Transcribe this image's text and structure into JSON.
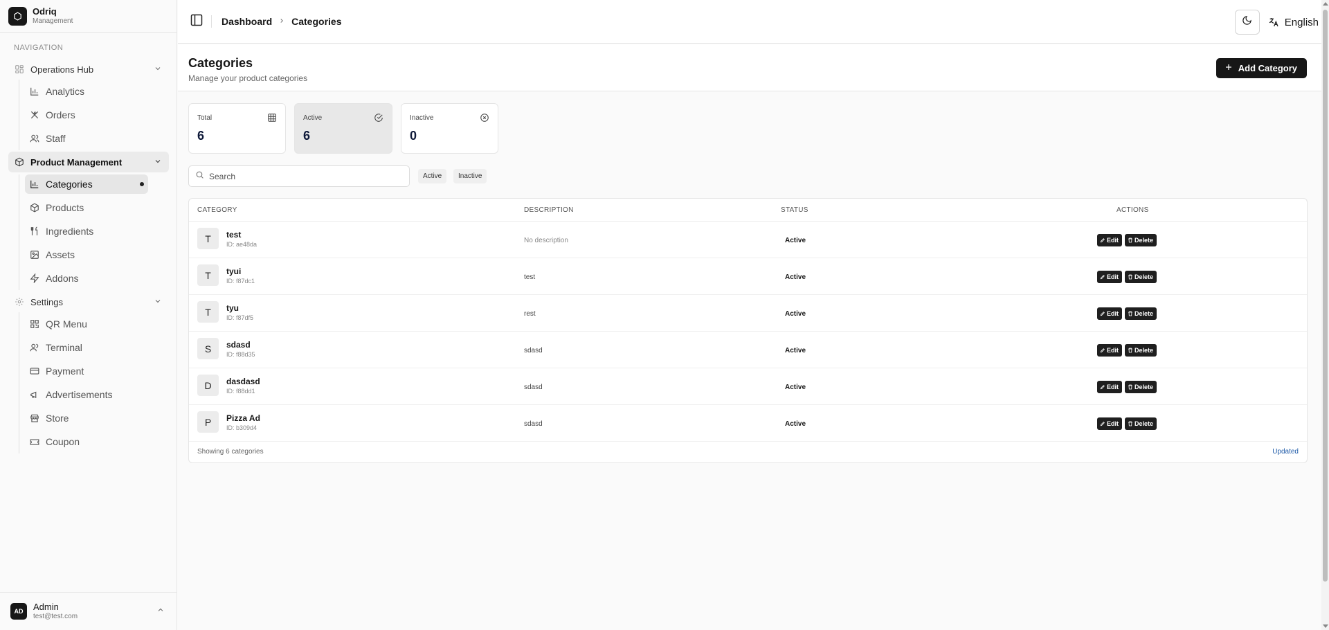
{
  "brand": {
    "name": "Odriq",
    "subtitle": "Management"
  },
  "nav_label": "NAVIGATION",
  "nav": {
    "operations": {
      "label": "Operations Hub",
      "items": [
        "Analytics",
        "Orders",
        "Staff"
      ]
    },
    "product": {
      "label": "Product Management",
      "items": [
        "Categories",
        "Products",
        "Ingredients",
        "Assets",
        "Addons"
      ]
    },
    "settings": {
      "label": "Settings",
      "items": [
        "QR Menu",
        "Terminal",
        "Payment",
        "Advertisements",
        "Store",
        "Coupon"
      ]
    }
  },
  "user": {
    "initials": "AD",
    "name": "Admin",
    "email": "test@test.com"
  },
  "header": {
    "breadcrumb": [
      "Dashboard",
      "Categories"
    ],
    "language": "English"
  },
  "page": {
    "title": "Categories",
    "subtitle": "Manage your product categories",
    "add_label": "Add Category"
  },
  "stats": [
    {
      "label": "Total",
      "value": "6"
    },
    {
      "label": "Active",
      "value": "6"
    },
    {
      "label": "Inactive",
      "value": "0"
    }
  ],
  "search": {
    "placeholder": "Search"
  },
  "filters": [
    "Active",
    "Inactive"
  ],
  "table": {
    "columns": [
      "CATEGORY",
      "DESCRIPTION",
      "STATUS",
      "ACTIONS"
    ],
    "rows": [
      {
        "letter": "T",
        "name": "test",
        "id": "ID: ae48da",
        "description": "No description",
        "status": "Active"
      },
      {
        "letter": "T",
        "name": "tyui",
        "id": "ID: f87dc1",
        "description": "test",
        "status": "Active"
      },
      {
        "letter": "T",
        "name": "tyu",
        "id": "ID: f87df5",
        "description": "rest",
        "status": "Active"
      },
      {
        "letter": "S",
        "name": "sdasd",
        "id": "ID: f88d35",
        "description": "sdasd",
        "status": "Active"
      },
      {
        "letter": "D",
        "name": "dasdasd",
        "id": "ID: f88dd1",
        "description": "sdasd",
        "status": "Active"
      },
      {
        "letter": "P",
        "name": "Pizza Ad",
        "id": "ID: b309d4",
        "description": "sdasd",
        "status": "Active"
      }
    ],
    "edit_label": "Edit",
    "delete_label": "Delete",
    "footer_count": "Showing 6 categories",
    "footer_status": "Updated"
  }
}
